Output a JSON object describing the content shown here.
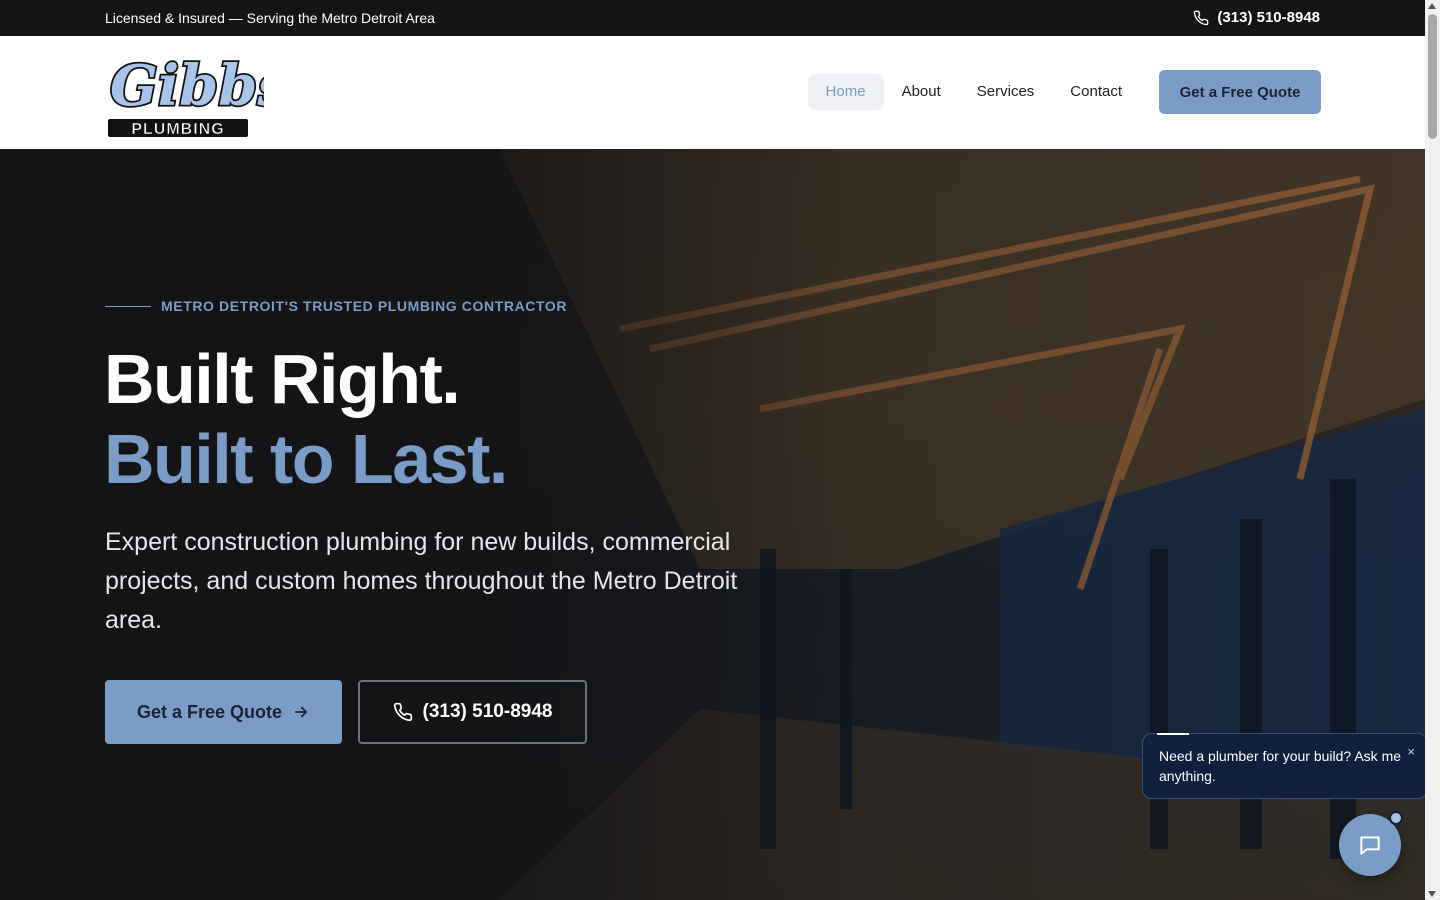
{
  "topbar": {
    "tagline": "Licensed & Insured — Serving the Metro Detroit Area",
    "phone": "(313) 510-8948"
  },
  "brand": {
    "logo_script": "Gibbs",
    "logo_sub": "PLUMBING"
  },
  "nav": {
    "items": [
      {
        "label": "Home",
        "active": true
      },
      {
        "label": "About",
        "active": false
      },
      {
        "label": "Services",
        "active": false
      },
      {
        "label": "Contact",
        "active": false
      }
    ],
    "cta": "Get a Free Quote"
  },
  "hero": {
    "eyebrow": "METRO DETROIT'S TRUSTED PLUMBING CONTRACTOR",
    "headline_1": "Built Right.",
    "headline_2": "Built to Last.",
    "lead": "Expert construction plumbing for new builds, commercial projects, and custom homes throughout the Metro Detroit area.",
    "cta_quote": "Get a Free Quote",
    "cta_phone": "(313) 510-8948"
  },
  "chat": {
    "message": "Need a plumber for your build? Ask me anything.",
    "close": "×"
  },
  "colors": {
    "accent": "#7c9cc8",
    "dark": "#141414",
    "chat_bg": "#0f1f3d"
  },
  "icons": [
    "phone-icon",
    "arrow-right-icon",
    "chat-icon",
    "close-icon"
  ]
}
